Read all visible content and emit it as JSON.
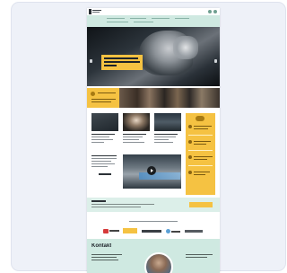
{
  "colors": {
    "mint": "#cfe9e1",
    "yellow": "#f5c242",
    "dark": "#1d232a",
    "card_bg": "#eef1f8"
  },
  "site": {
    "logo_text": "",
    "header_icons": [
      "search-icon",
      "menu-icon"
    ]
  },
  "hero": {
    "headline": "",
    "prev_icon": "chevron-left-icon",
    "next_icon": "chevron-right-icon"
  },
  "video": {
    "play_icon": "play-icon"
  },
  "footer": {
    "heading": "Kontakt"
  }
}
